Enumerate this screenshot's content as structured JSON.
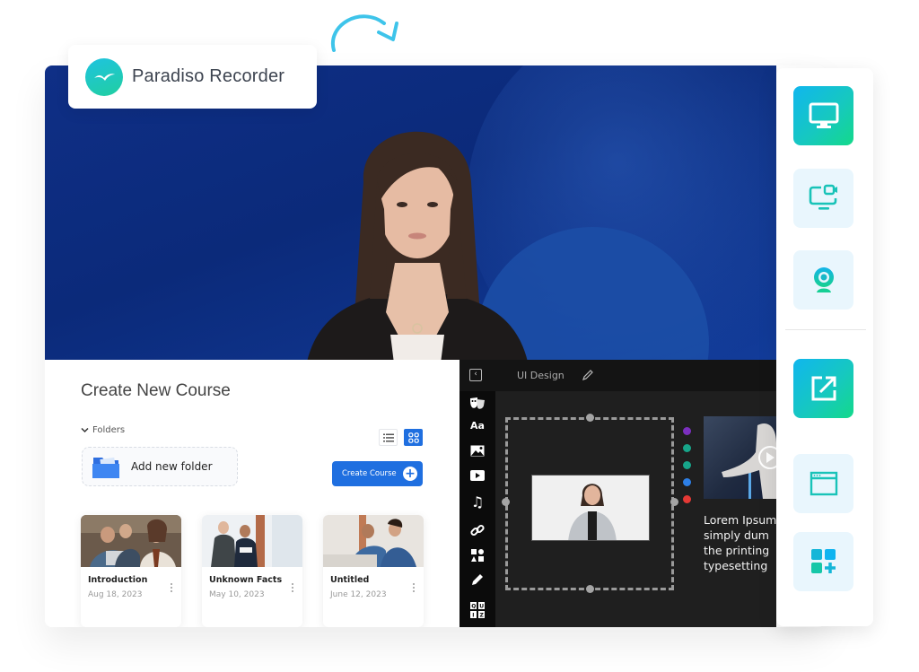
{
  "app": {
    "name": "Paradiso Recorder",
    "logo_icon": "seagull-logo-icon",
    "accent_gradient": [
      "#1fc3e0",
      "#20cfa0"
    ]
  },
  "hero": {
    "content": "presenter-video",
    "background_color": "#0f2f86"
  },
  "course_panel": {
    "title": "Create New Course",
    "folders_label": "Folders",
    "add_folder_label": "Add new folder",
    "create_button_label": "Create Course",
    "view_modes": [
      {
        "name": "list",
        "icon": "list-icon",
        "active": false
      },
      {
        "name": "grid",
        "icon": "grid-icon",
        "active": true
      }
    ],
    "primary_color": "#1f6fe0",
    "courses": [
      {
        "title": "Introduction",
        "date": "Aug 18, 2023"
      },
      {
        "title": "Unknown Facts",
        "date": "May 10, 2023"
      },
      {
        "title": "Untitled",
        "date": "June 12, 2023"
      }
    ]
  },
  "editor": {
    "document_title": "UI Design",
    "tools": [
      {
        "name": "avatar",
        "icon": "theater-masks-icon"
      },
      {
        "name": "text",
        "icon": "text-icon",
        "glyph": "Aa"
      },
      {
        "name": "image",
        "icon": "image-icon"
      },
      {
        "name": "video",
        "icon": "video-play-icon"
      },
      {
        "name": "audio",
        "icon": "music-note-icon"
      },
      {
        "name": "link",
        "icon": "link-icon"
      },
      {
        "name": "shapes",
        "icon": "shapes-icon"
      },
      {
        "name": "draw",
        "icon": "pencil-icon"
      },
      {
        "name": "quiz",
        "icon": "quiz-icon",
        "glyph": "QUIZ"
      }
    ],
    "element_actions": [
      {
        "name": "edit",
        "color": "#7b2fbf"
      },
      {
        "name": "align-bottom",
        "color": "#17a58a"
      },
      {
        "name": "align-top",
        "color": "#17a58a"
      },
      {
        "name": "crop",
        "color": "#2d7fe6"
      },
      {
        "name": "delete",
        "color": "#e53935"
      }
    ],
    "side_text_lines": [
      "Lorem Ipsum",
      "simply dum",
      "the printing",
      "typesetting"
    ]
  },
  "right_toolbar": {
    "buttons": [
      {
        "name": "screen",
        "icon": "monitor-icon",
        "active": true
      },
      {
        "name": "screen-and-camera",
        "icon": "screen-camera-icon",
        "active": false
      },
      {
        "name": "webcam",
        "icon": "webcam-icon",
        "active": false
      },
      {
        "name": "export",
        "icon": "external-link-icon",
        "active": true
      },
      {
        "name": "browser-window",
        "icon": "browser-window-icon",
        "active": false
      },
      {
        "name": "add-widget",
        "icon": "add-widget-icon",
        "active": false
      }
    ]
  }
}
